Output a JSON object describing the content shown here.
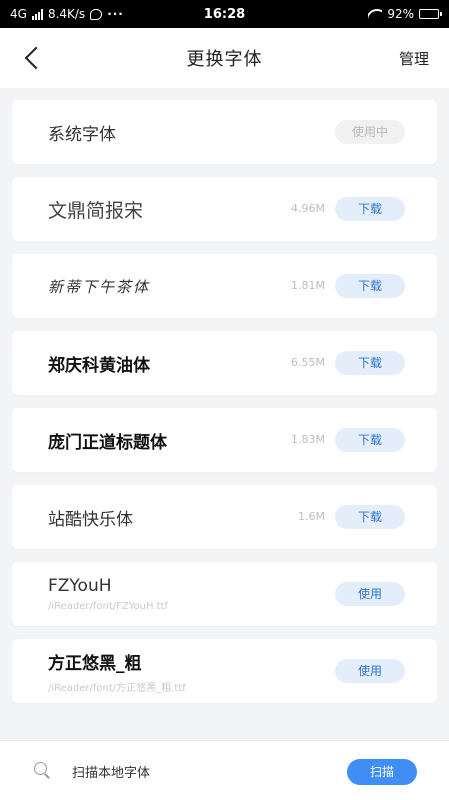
{
  "status_bar": {
    "network": "4G",
    "speed": "8.4K/s",
    "time": "16:28",
    "battery": "92%"
  },
  "header": {
    "title": "更换字体",
    "manage": "管理"
  },
  "fonts": [
    {
      "name": "系统字体",
      "size": "",
      "path": "",
      "action": "使用中"
    },
    {
      "name": "文鼎简报宋",
      "size": "4.96M",
      "path": "",
      "action": "下载"
    },
    {
      "name": "新蒂下午茶体",
      "size": "1.81M",
      "path": "",
      "action": "下载"
    },
    {
      "name": "郑庆科黄油体",
      "size": "6.55M",
      "path": "",
      "action": "下载"
    },
    {
      "name": "庞门正道标题体",
      "size": "1.83M",
      "path": "",
      "action": "下载"
    },
    {
      "name": "站酷快乐体",
      "size": "1.6M",
      "path": "",
      "action": "下载"
    },
    {
      "name": "FZYouH",
      "size": "",
      "path": "/iReader/font/FZYouH.ttf",
      "action": "使用"
    },
    {
      "name": "方正悠黑_粗",
      "size": "",
      "path": "/iReader/font/方正悠黑_粗.ttf",
      "action": "使用"
    }
  ],
  "bottom_bar": {
    "label": "扫描本地字体",
    "button": "扫描"
  },
  "colors": {
    "accent": "#3f8ef5",
    "download_bg": "#e4eefb",
    "download_text": "#2f74d0"
  }
}
